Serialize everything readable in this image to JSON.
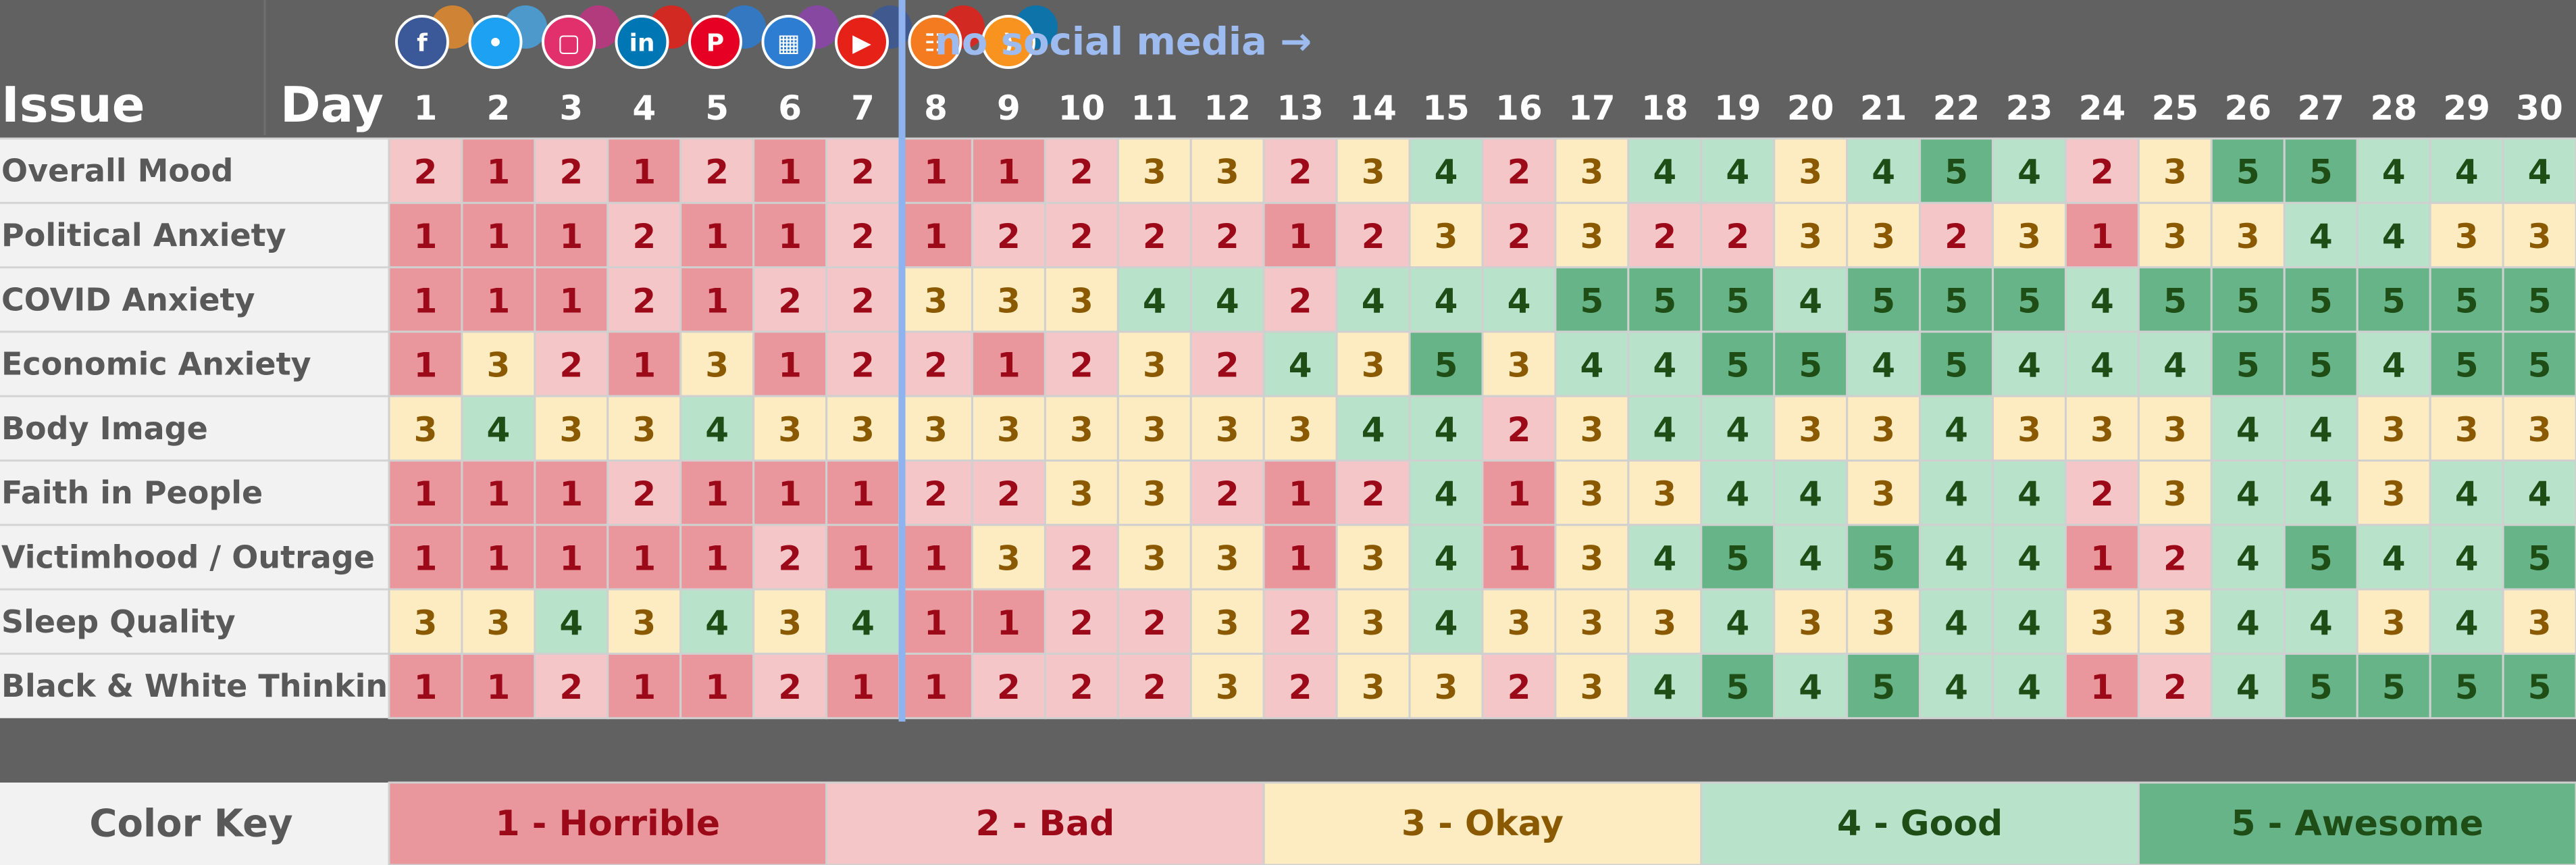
{
  "header": {
    "issue_label": "Issue",
    "day_label": "Day",
    "annotation": "no social media →"
  },
  "icons": [
    "facebook-icon",
    "twitter-icon",
    "instagram-icon",
    "linkedin-icon",
    "pinterest-icon",
    "calendar-icon",
    "youtube-icon",
    "analytics-icon",
    "rss-icon"
  ],
  "colors": {
    "1": "#E9969C",
    "2": "#F5C6C8",
    "3": "#FDEBC1",
    "4": "#B8E2CA",
    "5": "#68B489",
    "background": "#616161",
    "divider": "#8FB3EE"
  },
  "chart_data": {
    "type": "heatmap",
    "x": [
      "1",
      "2",
      "3",
      "4",
      "5",
      "6",
      "7",
      "8",
      "9",
      "10",
      "11",
      "12",
      "13",
      "14",
      "15",
      "16",
      "17",
      "18",
      "19",
      "20",
      "21",
      "22",
      "23",
      "24",
      "25",
      "26",
      "27",
      "28",
      "29",
      "30"
    ],
    "y": [
      "Overall Mood",
      "Political Anxiety",
      "COVID Anxiety",
      "Economic Anxiety",
      "Body Image",
      "Faith in People",
      "Victimhood / Outrage",
      "Sleep Quality",
      "Black & White Thinking"
    ],
    "values": [
      [
        2,
        1,
        2,
        1,
        2,
        1,
        2,
        1,
        1,
        2,
        3,
        3,
        2,
        3,
        4,
        2,
        3,
        4,
        4,
        3,
        4,
        5,
        4,
        2,
        3,
        5,
        5,
        4,
        4,
        4
      ],
      [
        1,
        1,
        1,
        2,
        1,
        1,
        2,
        1,
        2,
        2,
        2,
        2,
        1,
        2,
        3,
        2,
        3,
        2,
        2,
        3,
        3,
        2,
        3,
        1,
        3,
        3,
        4,
        4,
        3,
        3
      ],
      [
        1,
        1,
        1,
        2,
        1,
        2,
        2,
        3,
        3,
        3,
        4,
        4,
        2,
        4,
        4,
        4,
        5,
        5,
        5,
        4,
        5,
        5,
        5,
        4,
        5,
        5,
        5,
        5,
        5,
        5
      ],
      [
        1,
        3,
        2,
        1,
        3,
        1,
        2,
        2,
        1,
        2,
        3,
        2,
        4,
        3,
        5,
        3,
        4,
        4,
        5,
        5,
        4,
        5,
        4,
        4,
        4,
        5,
        5,
        4,
        5,
        5
      ],
      [
        3,
        4,
        3,
        3,
        4,
        3,
        3,
        3,
        3,
        3,
        3,
        3,
        3,
        4,
        4,
        2,
        3,
        4,
        4,
        3,
        3,
        4,
        3,
        3,
        3,
        4,
        4,
        3,
        3,
        3
      ],
      [
        1,
        1,
        1,
        2,
        1,
        1,
        1,
        2,
        2,
        3,
        3,
        2,
        1,
        2,
        4,
        1,
        3,
        3,
        4,
        4,
        3,
        4,
        4,
        2,
        3,
        4,
        4,
        3,
        4,
        4
      ],
      [
        1,
        1,
        1,
        1,
        1,
        2,
        1,
        1,
        3,
        2,
        3,
        3,
        1,
        3,
        4,
        1,
        3,
        4,
        5,
        4,
        5,
        4,
        4,
        1,
        2,
        4,
        5,
        4,
        4,
        5
      ],
      [
        3,
        3,
        4,
        3,
        4,
        3,
        4,
        1,
        1,
        2,
        2,
        3,
        2,
        3,
        4,
        3,
        3,
        3,
        4,
        3,
        3,
        4,
        4,
        3,
        3,
        4,
        4,
        3,
        4,
        3
      ],
      [
        1,
        1,
        2,
        1,
        1,
        2,
        1,
        1,
        2,
        2,
        2,
        3,
        2,
        3,
        3,
        2,
        3,
        4,
        5,
        4,
        5,
        4,
        4,
        1,
        2,
        4,
        5,
        5,
        5,
        5
      ]
    ],
    "legend": [
      {
        "value": 1,
        "label": "1 - Horrible"
      },
      {
        "value": 2,
        "label": "2 - Bad"
      },
      {
        "value": 3,
        "label": "3 - Okay"
      },
      {
        "value": 4,
        "label": "4 - Good"
      },
      {
        "value": 5,
        "label": "5 - Awesome"
      }
    ],
    "legend_title": "Color Key",
    "divider_after_day": 7
  }
}
